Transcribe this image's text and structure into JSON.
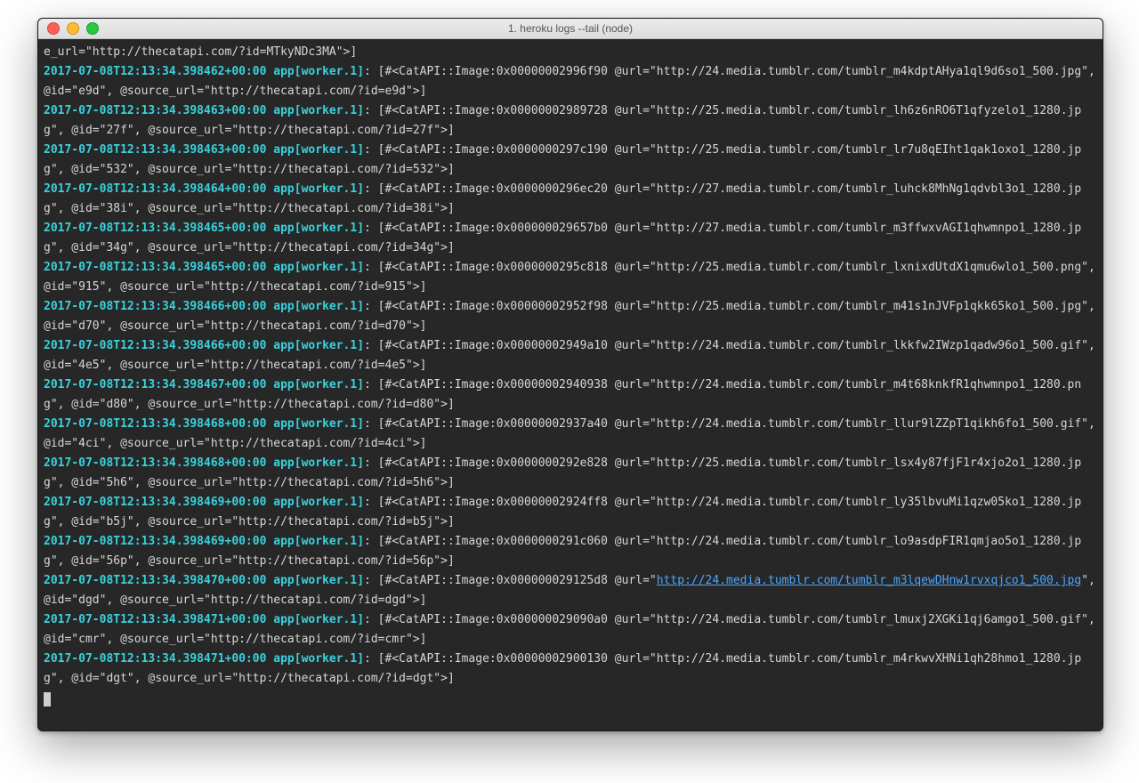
{
  "window": {
    "title": "1. heroku logs --tail (node)"
  },
  "partial_first_line": "e_url=\"http://thecatapi.com/?id=MTkyNDc3MA\">]",
  "log_lines": [
    {
      "timestamp": "2017-07-08T12:13:34.398462+00:00",
      "source": "app[worker.1]",
      "body": "[#<CatAPI::Image:0x00000002996f90 @url=\"http://24.media.tumblr.com/tumblr_m4kdptAHya1ql9d6so1_500.jpg\", @id=\"e9d\", @source_url=\"http://thecatapi.com/?id=e9d\">]",
      "highlighted_url": null
    },
    {
      "timestamp": "2017-07-08T12:13:34.398463+00:00",
      "source": "app[worker.1]",
      "body": "[#<CatAPI::Image:0x00000002989728 @url=\"http://25.media.tumblr.com/tumblr_lh6z6nRO6T1qfyzelo1_1280.jpg\", @id=\"27f\", @source_url=\"http://thecatapi.com/?id=27f\">]",
      "highlighted_url": null
    },
    {
      "timestamp": "2017-07-08T12:13:34.398463+00:00",
      "source": "app[worker.1]",
      "body": "[#<CatAPI::Image:0x0000000297c190 @url=\"http://25.media.tumblr.com/tumblr_lr7u8qEIht1qak1oxo1_1280.jpg\", @id=\"532\", @source_url=\"http://thecatapi.com/?id=532\">]",
      "highlighted_url": null
    },
    {
      "timestamp": "2017-07-08T12:13:34.398464+00:00",
      "source": "app[worker.1]",
      "body": "[#<CatAPI::Image:0x0000000296ec20 @url=\"http://27.media.tumblr.com/tumblr_luhck8MhNg1qdvbl3o1_1280.jpg\", @id=\"38i\", @source_url=\"http://thecatapi.com/?id=38i\">]",
      "highlighted_url": null
    },
    {
      "timestamp": "2017-07-08T12:13:34.398465+00:00",
      "source": "app[worker.1]",
      "body": "[#<CatAPI::Image:0x000000029657b0 @url=\"http://27.media.tumblr.com/tumblr_m3ffwxvAGI1qhwmnpo1_1280.jpg\", @id=\"34g\", @source_url=\"http://thecatapi.com/?id=34g\">]",
      "highlighted_url": null
    },
    {
      "timestamp": "2017-07-08T12:13:34.398465+00:00",
      "source": "app[worker.1]",
      "body": "[#<CatAPI::Image:0x0000000295c818 @url=\"http://25.media.tumblr.com/tumblr_lxnixdUtdX1qmu6wlo1_500.png\", @id=\"915\", @source_url=\"http://thecatapi.com/?id=915\">]",
      "highlighted_url": null
    },
    {
      "timestamp": "2017-07-08T12:13:34.398466+00:00",
      "source": "app[worker.1]",
      "body": "[#<CatAPI::Image:0x00000002952f98 @url=\"http://25.media.tumblr.com/tumblr_m41s1nJVFp1qkk65ko1_500.jpg\", @id=\"d70\", @source_url=\"http://thecatapi.com/?id=d70\">]",
      "highlighted_url": null
    },
    {
      "timestamp": "2017-07-08T12:13:34.398466+00:00",
      "source": "app[worker.1]",
      "body": "[#<CatAPI::Image:0x00000002949a10 @url=\"http://24.media.tumblr.com/tumblr_lkkfw2IWzp1qadw96o1_500.gif\", @id=\"4e5\", @source_url=\"http://thecatapi.com/?id=4e5\">]",
      "highlighted_url": null
    },
    {
      "timestamp": "2017-07-08T12:13:34.398467+00:00",
      "source": "app[worker.1]",
      "body": "[#<CatAPI::Image:0x00000002940938 @url=\"http://24.media.tumblr.com/tumblr_m4t68knkfR1qhwmnpo1_1280.png\", @id=\"d80\", @source_url=\"http://thecatapi.com/?id=d80\">]",
      "highlighted_url": null
    },
    {
      "timestamp": "2017-07-08T12:13:34.398468+00:00",
      "source": "app[worker.1]",
      "body": "[#<CatAPI::Image:0x00000002937a40 @url=\"http://24.media.tumblr.com/tumblr_llur9lZZpT1qikh6fo1_500.gif\", @id=\"4ci\", @source_url=\"http://thecatapi.com/?id=4ci\">]",
      "highlighted_url": null
    },
    {
      "timestamp": "2017-07-08T12:13:34.398468+00:00",
      "source": "app[worker.1]",
      "body": "[#<CatAPI::Image:0x0000000292e828 @url=\"http://25.media.tumblr.com/tumblr_lsx4y87fjF1r4xjo2o1_1280.jpg\", @id=\"5h6\", @source_url=\"http://thecatapi.com/?id=5h6\">]",
      "highlighted_url": null
    },
    {
      "timestamp": "2017-07-08T12:13:34.398469+00:00",
      "source": "app[worker.1]",
      "body": "[#<CatAPI::Image:0x00000002924ff8 @url=\"http://24.media.tumblr.com/tumblr_ly35lbvuMi1qzw05ko1_1280.jpg\", @id=\"b5j\", @source_url=\"http://thecatapi.com/?id=b5j\">]",
      "highlighted_url": null
    },
    {
      "timestamp": "2017-07-08T12:13:34.398469+00:00",
      "source": "app[worker.1]",
      "body": "[#<CatAPI::Image:0x0000000291c060 @url=\"http://24.media.tumblr.com/tumblr_lo9asdpFIR1qmjao5o1_1280.jpg\", @id=\"56p\", @source_url=\"http://thecatapi.com/?id=56p\">]",
      "highlighted_url": null
    },
    {
      "timestamp": "2017-07-08T12:13:34.398470+00:00",
      "source": "app[worker.1]",
      "body": "[#<CatAPI::Image:0x000000029125d8 @url=\"http://24.media.tumblr.com/tumblr_m3lqewDHnw1rvxqjco1_500.jpg\", @id=\"dgd\", @source_url=\"http://thecatapi.com/?id=dgd\">]",
      "highlighted_url": "http://24.media.tumblr.com/tumblr_m3lqewDHnw1rvxqjco1_500.jpg"
    },
    {
      "timestamp": "2017-07-08T12:13:34.398471+00:00",
      "source": "app[worker.1]",
      "body": "[#<CatAPI::Image:0x000000029090a0 @url=\"http://24.media.tumblr.com/tumblr_lmuxj2XGKi1qj6amgo1_500.gif\", @id=\"cmr\", @source_url=\"http://thecatapi.com/?id=cmr\">]",
      "highlighted_url": null
    },
    {
      "timestamp": "2017-07-08T12:13:34.398471+00:00",
      "source": "app[worker.1]",
      "body": "[#<CatAPI::Image:0x00000002900130 @url=\"http://24.media.tumblr.com/tumblr_m4rkwvXHNi1qh28hmo1_1280.jpg\", @id=\"dgt\", @source_url=\"http://thecatapi.com/?id=dgt\">]",
      "highlighted_url": null
    }
  ]
}
